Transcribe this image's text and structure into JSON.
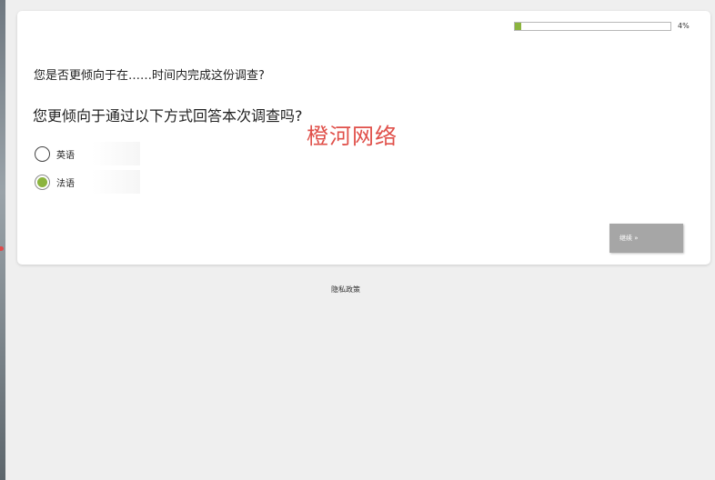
{
  "progress": {
    "percent_label": "4%",
    "fraction": 0.04,
    "fill_color": "#8bb43e"
  },
  "survey": {
    "intro_question": "您是否更倾向于在……时间内完成这份调查?",
    "main_question": "您更倾向于通过以下方式回答本次调查吗?",
    "options": [
      {
        "label": "英语",
        "selected": false
      },
      {
        "label": "法语",
        "selected": true
      }
    ],
    "continue_label": "继续 »"
  },
  "watermark": "橙河网络",
  "footer": {
    "privacy_label": "隐私政策"
  },
  "colors": {
    "accent": "#8bb43e",
    "watermark": "#e0504a",
    "button": "#a6a6a6",
    "page_bg": "#efefef"
  }
}
